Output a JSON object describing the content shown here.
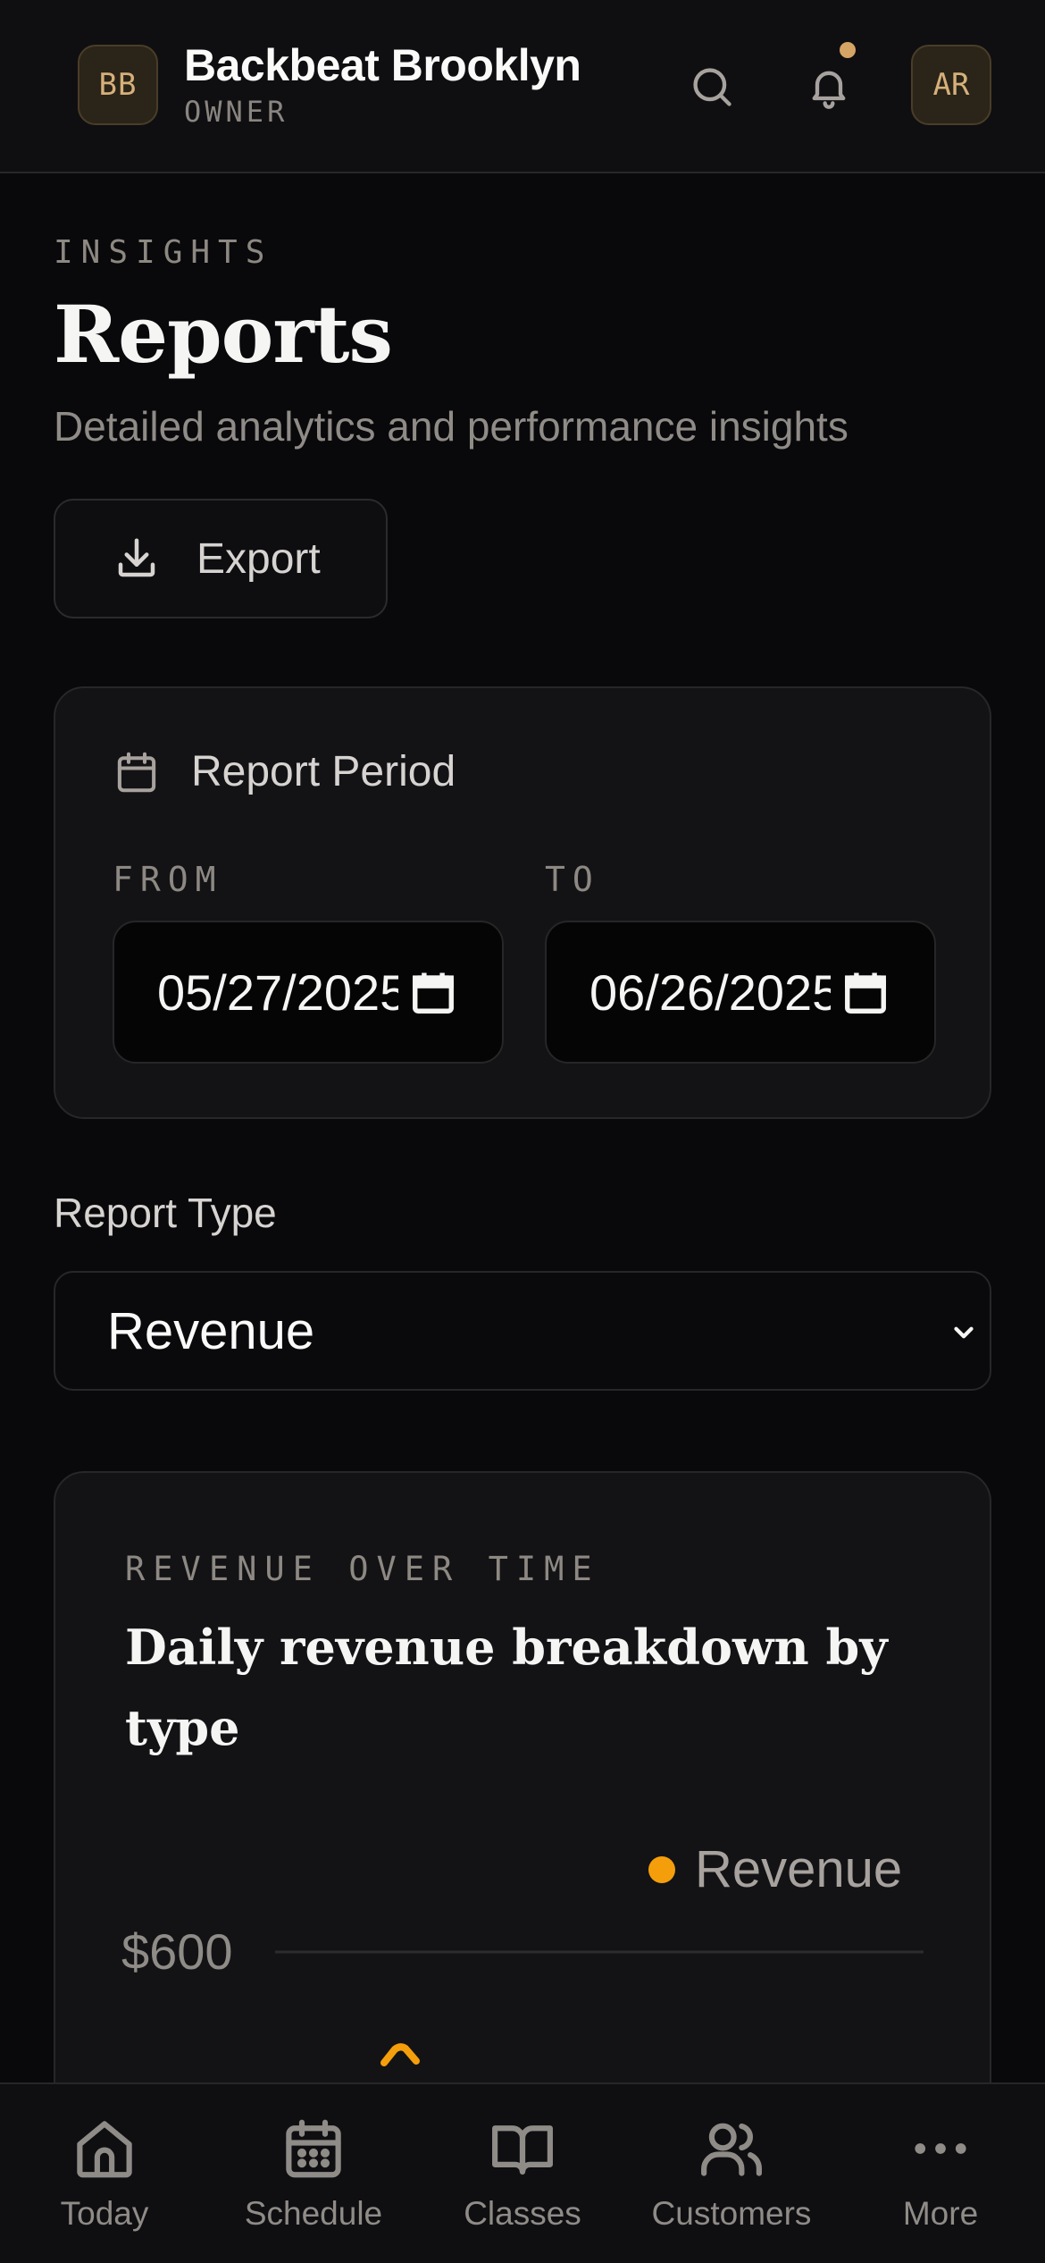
{
  "header": {
    "org_initials": "BB",
    "org_name": "Backbeat Brooklyn",
    "role": "OWNER",
    "user_initials": "AR",
    "has_notifications": true
  },
  "page": {
    "eyebrow": "INSIGHTS",
    "title": "Reports",
    "subtitle": "Detailed analytics and performance insights",
    "export_label": "Export"
  },
  "period": {
    "title": "Report Period",
    "from_label": "FROM",
    "from_value": "05/27/2025",
    "to_label": "TO",
    "to_value": "06/26/2025"
  },
  "report_type": {
    "label": "Report Type",
    "selected": "Revenue"
  },
  "chart_card": {
    "eyebrow": "REVENUE OVER TIME",
    "title": "Daily revenue breakdown by type"
  },
  "chart_data": {
    "type": "line",
    "title": "Daily revenue breakdown by type",
    "series": [
      {
        "name": "Revenue",
        "color": "#f59e0b"
      }
    ],
    "y_ticks": [
      "$600"
    ],
    "legend": "top-right"
  },
  "nav": {
    "items": [
      {
        "label": "Today",
        "icon": "home-icon"
      },
      {
        "label": "Schedule",
        "icon": "calendar-icon"
      },
      {
        "label": "Classes",
        "icon": "book-icon"
      },
      {
        "label": "Customers",
        "icon": "users-icon"
      },
      {
        "label": "More",
        "icon": "more-icon"
      }
    ]
  },
  "colors": {
    "accent": "#d6a464",
    "series": "#f59e0b",
    "background": "#09090b"
  }
}
